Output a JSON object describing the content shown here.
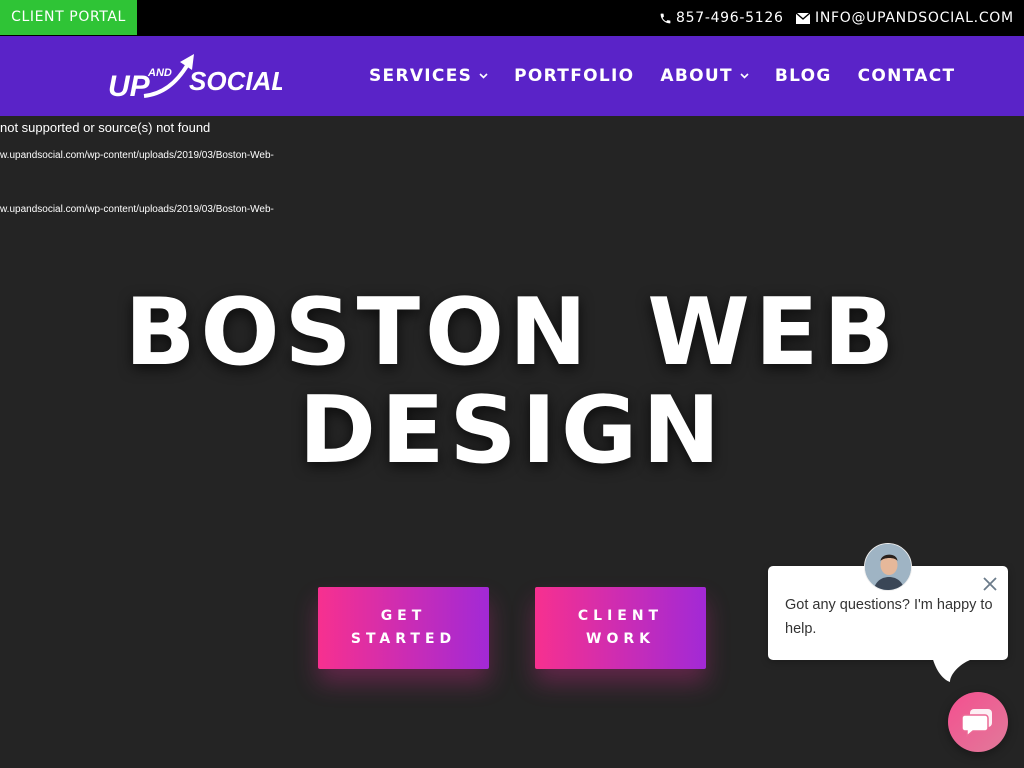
{
  "topbar": {
    "client_portal": "CLIENT PORTAL",
    "phone": "857-496-5126",
    "email": "INFO@UPANDSOCIAL.COM",
    "colors": {
      "bar": "#000000",
      "client_portal_bg": "#2fc436"
    }
  },
  "header": {
    "logo": {
      "word_up": "UP",
      "word_and": "AND",
      "word_social": "SOCIAL"
    },
    "nav": [
      {
        "label": "SERVICES",
        "has_dropdown": true
      },
      {
        "label": "PORTFOLIO",
        "has_dropdown": false
      },
      {
        "label": "ABOUT",
        "has_dropdown": true
      },
      {
        "label": "BLOG",
        "has_dropdown": false
      },
      {
        "label": "CONTACT",
        "has_dropdown": false
      }
    ],
    "colors": {
      "background": "#5a23c8"
    }
  },
  "media_errors": {
    "line1": "not supported or source(s) not found",
    "line2": "w.upandsocial.com/wp-content/uploads/2019/03/Boston-Web-",
    "line3": "w.upandsocial.com/wp-content/uploads/2019/03/Boston-Web-"
  },
  "hero": {
    "title_line1": "BOSTON WEB",
    "title_line2": "DESIGN",
    "buttons": {
      "get_started_line1": "GET",
      "get_started_line2": "STARTED",
      "client_work_line1": "CLIENT",
      "client_work_line2": "WORK"
    },
    "colors": {
      "background": "#242424",
      "gradient_start": "#f7308f",
      "gradient_end": "#a229d6"
    }
  },
  "chat": {
    "message": "Got any questions? I'm happy to help.",
    "icons": {
      "close": "close-icon",
      "launcher": "chat-bubble-icon",
      "avatar": "agent-avatar"
    },
    "colors": {
      "launcher": "#f44f8f"
    }
  }
}
